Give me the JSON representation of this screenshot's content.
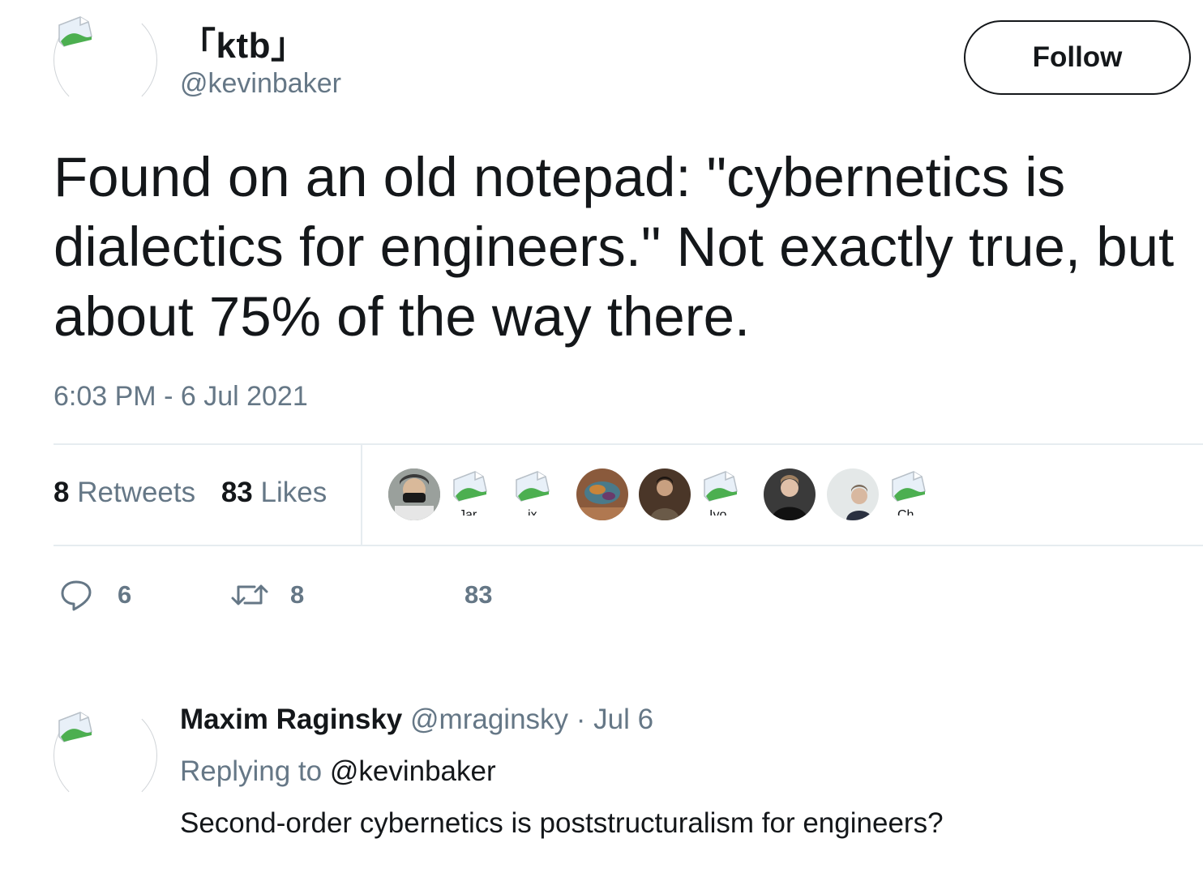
{
  "tweet": {
    "author": {
      "display_name": "「ktb」",
      "handle": "@kevinbaker",
      "avatar_icon": "broken-image-icon"
    },
    "follow_label": "Follow",
    "text": "Found on an old notepad: \"cybernetics is dialectics for engineers.\" Not exactly true, but about 75% of the way there.",
    "timestamp": "6:03 PM - 6 Jul 2021",
    "stats": {
      "retweets_count": "8",
      "retweets_label": "Retweets",
      "likes_count": "83",
      "likes_label": "Likes"
    },
    "likers": [
      {
        "type": "photo",
        "color": "#8a8f8c"
      },
      {
        "type": "broken",
        "alt": "Jar"
      },
      {
        "type": "broken",
        "alt": "ix"
      },
      {
        "type": "photo",
        "color": "#a06a4a"
      },
      {
        "type": "photo",
        "color": "#5a4030"
      },
      {
        "type": "broken",
        "alt": "Iyo"
      },
      {
        "type": "photo",
        "color": "#2a2a2a"
      },
      {
        "type": "photo",
        "color": "#d8dcdc"
      },
      {
        "type": "broken",
        "alt": "Ch"
      }
    ],
    "actions": {
      "reply_count": "6",
      "retweet_count": "8",
      "like_count": "83"
    }
  },
  "reply": {
    "display_name": "Maxim Raginsky",
    "handle_date": "@mraginsky · Jul 6",
    "replying_prefix": "Replying to",
    "replying_handle": "@kevinbaker",
    "text": "Second-order cybernetics is poststructuralism for engineers?",
    "avatar_icon": "broken-image-icon"
  },
  "colors": {
    "text": "#14171a",
    "secondary": "#657786",
    "border": "#e6ecf0"
  }
}
